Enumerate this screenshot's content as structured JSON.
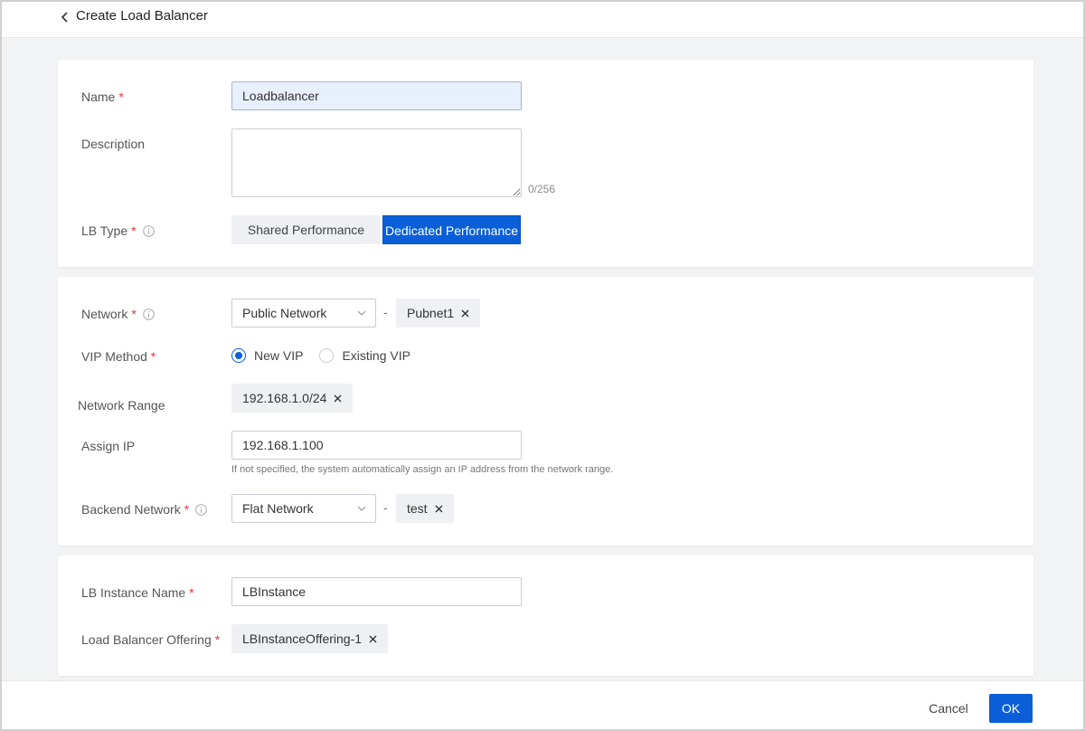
{
  "header": {
    "title": "Create Load Balancer",
    "back_icon": "chevron-left-icon"
  },
  "basic": {
    "name_label": "Name",
    "name_value": "Loadbalancer",
    "description_label": "Description",
    "description_value": "",
    "description_counter": "0/256",
    "lb_type_label": "LB Type",
    "lb_type_options": [
      "Shared Performance",
      "Dedicated Performance"
    ],
    "lb_type_selected": "Dedicated Performance"
  },
  "network": {
    "network_label": "Network",
    "network_select": "Public Network",
    "network_separator": "-",
    "network_tag": "Pubnet1",
    "vip_method_label": "VIP Method",
    "vip_options": [
      "New VIP",
      "Existing VIP"
    ],
    "vip_selected": "New VIP",
    "network_range_label": "Network Range",
    "network_range_tag": "192.168.1.0/24",
    "assign_ip_label": "Assign IP",
    "assign_ip_value": "192.168.1.100",
    "assign_ip_hint": "If not specified, the system automatically assign an IP address from the network range.",
    "backend_network_label": "Backend Network",
    "backend_network_select": "Flat Network",
    "backend_separator": "-",
    "backend_tag": "test"
  },
  "instance": {
    "instance_name_label": "LB Instance Name",
    "instance_name_value": "LBInstance",
    "offering_label": "Load Balancer Offering",
    "offering_tag": "LBInstanceOffering-1"
  },
  "footer": {
    "cancel_label": "Cancel",
    "ok_label": "OK"
  },
  "colors": {
    "primary": "#0a5fd9",
    "required": "#e0373a",
    "page_bg": "#f2f3f5"
  }
}
